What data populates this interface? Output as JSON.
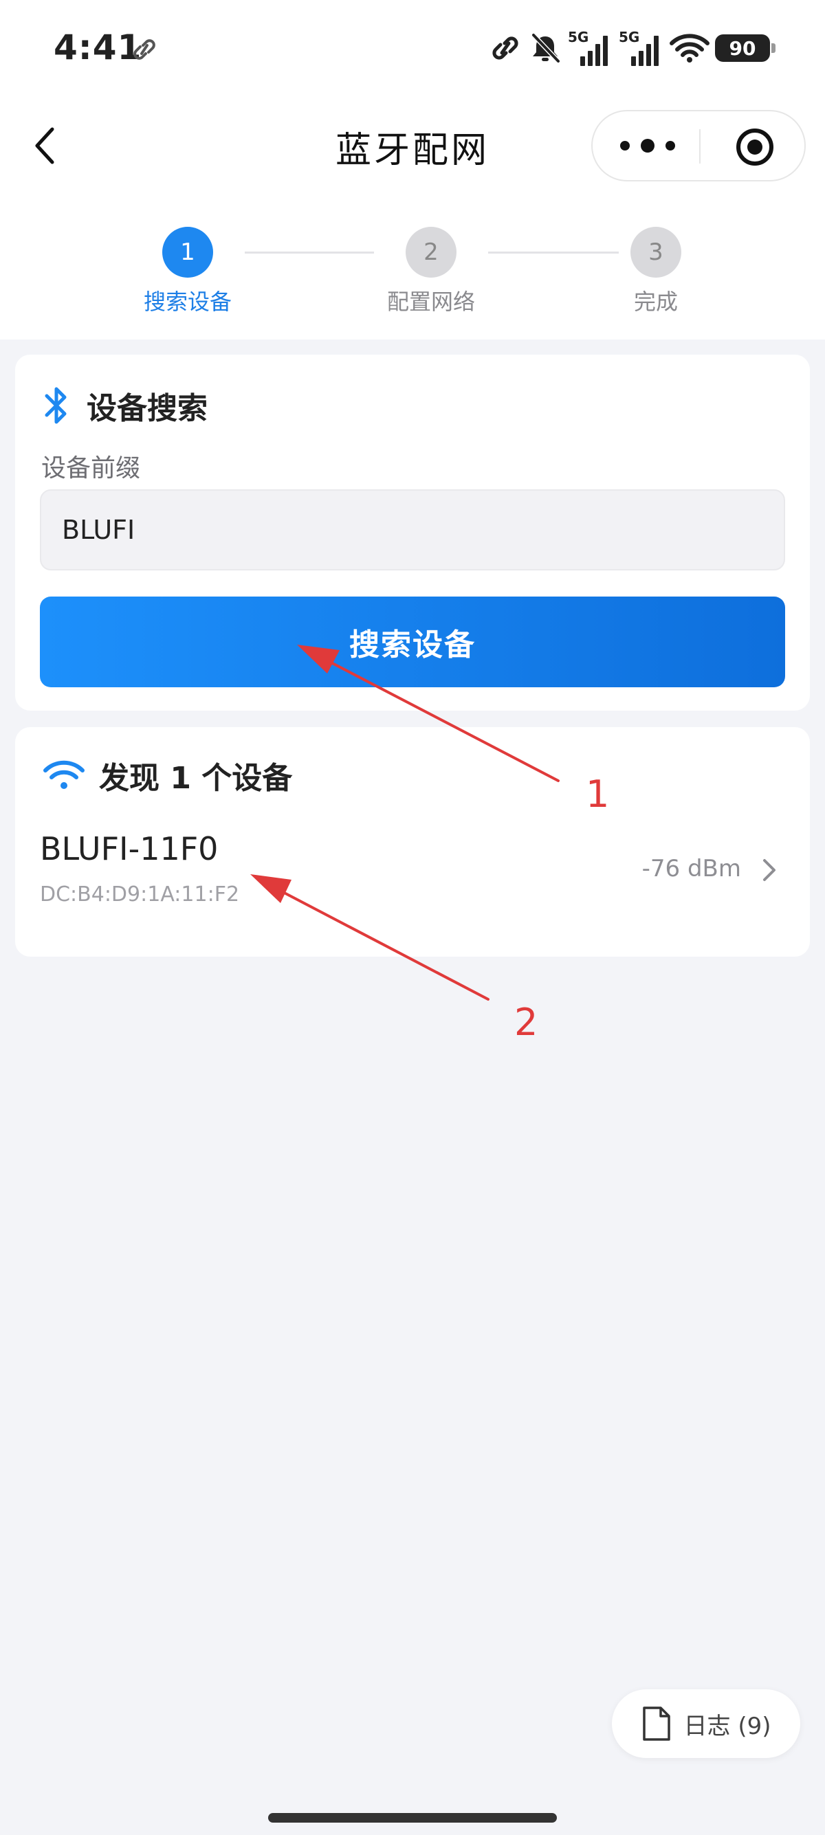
{
  "status_bar": {
    "time": "4:41",
    "network_1": "5G",
    "network_2": "5G",
    "battery": "90"
  },
  "nav": {
    "title": "蓝牙配网"
  },
  "stepper": {
    "steps": [
      {
        "number": "1",
        "label": "搜索设备",
        "state": "active"
      },
      {
        "number": "2",
        "label": "配置网络",
        "state": "inactive"
      },
      {
        "number": "3",
        "label": "完成",
        "state": "inactive"
      }
    ]
  },
  "search_card": {
    "title": "设备搜索",
    "icon": "bluetooth-icon",
    "prefix_label": "设备前缀",
    "prefix_value": "BLUFI",
    "button_label": "搜索设备"
  },
  "found_card": {
    "title": "发现 1 个设备",
    "icon": "wifi-icon",
    "devices": [
      {
        "name": "BLUFI-11F0",
        "mac": "DC:B4:D9:1A:11:F2",
        "rssi": "-76 dBm"
      }
    ]
  },
  "log_button": {
    "label": "日志 (9)"
  },
  "annotations": {
    "label_1": "1",
    "label_2": "2",
    "color": "#e03a3a"
  },
  "colors": {
    "accent": "#1e88f0",
    "background": "#f3f4f8"
  }
}
